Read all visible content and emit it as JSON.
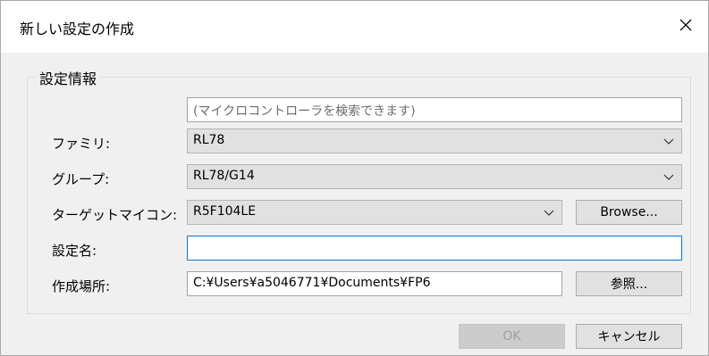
{
  "window": {
    "title": "新しい設定の作成"
  },
  "group": {
    "legend": "設定情報"
  },
  "search": {
    "placeholder": "(マイクロコントローラを検索できます)"
  },
  "family": {
    "label": "ファミリ:",
    "value": "RL78"
  },
  "group_select": {
    "label": "グループ:",
    "value": "RL78/G14"
  },
  "target": {
    "label": "ターゲットマイコン:",
    "value": "R5F104LE",
    "browse_label": "Browse..."
  },
  "setting_name": {
    "label": "設定名:",
    "value": ""
  },
  "location": {
    "label": "作成場所:",
    "value": "C:¥Users¥a5046771¥Documents¥FP6",
    "ref_label": "参照..."
  },
  "footer": {
    "ok_label": "OK",
    "cancel_label": "キャンセル"
  },
  "icons": {
    "close": "close-icon",
    "chevron": "chevron-down-icon"
  }
}
